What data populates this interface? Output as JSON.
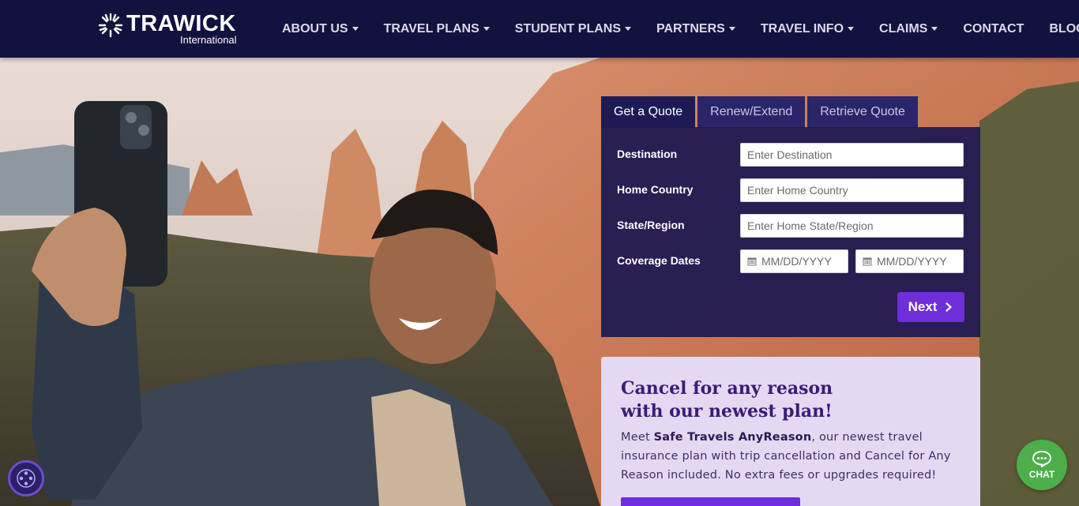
{
  "header": {
    "logo_word": "TRAWICK",
    "logo_sub": "International",
    "nav": [
      {
        "label": "ABOUT US",
        "dropdown": true
      },
      {
        "label": "TRAVEL PLANS",
        "dropdown": true
      },
      {
        "label": "STUDENT PLANS",
        "dropdown": true
      },
      {
        "label": "PARTNERS",
        "dropdown": true
      },
      {
        "label": "TRAVEL INFO",
        "dropdown": true
      },
      {
        "label": "CLAIMS",
        "dropdown": true
      },
      {
        "label": "CONTACT",
        "dropdown": false
      },
      {
        "label": "BLOG",
        "dropdown": false
      }
    ]
  },
  "quote": {
    "tabs": [
      {
        "label": "Get a Quote",
        "active": true
      },
      {
        "label": "Renew/Extend",
        "active": false
      },
      {
        "label": "Retrieve Quote",
        "active": false
      }
    ],
    "fields": {
      "destination": {
        "label": "Destination",
        "placeholder": "Enter Destination"
      },
      "home_country": {
        "label": "Home Country",
        "placeholder": "Enter Home Country"
      },
      "state_region": {
        "label": "State/Region",
        "placeholder": "Enter Home State/Region"
      },
      "coverage_dates": {
        "label": "Coverage Dates",
        "start_placeholder": "MM/DD/YYYY",
        "end_placeholder": "MM/DD/YYYY"
      }
    },
    "next_label": "Next"
  },
  "promo": {
    "title_line1": "Cancel for any reason",
    "title_line2": "with our newest plan!",
    "body_prefix": "Meet ",
    "body_bold": "Safe Travels AnyReason",
    "body_suffix": ", our newest travel insurance plan with trip cancellation and Cancel for Any Reason included. No extra fees or upgrades required!"
  },
  "widgets": {
    "chat_label": "CHAT"
  },
  "colors": {
    "header_bg": "#12123f",
    "panel_bg": "#1c1852",
    "accent": "#6c2fd9",
    "promo_bg": "#e5d8f3",
    "chat_green": "#4caf4a"
  }
}
